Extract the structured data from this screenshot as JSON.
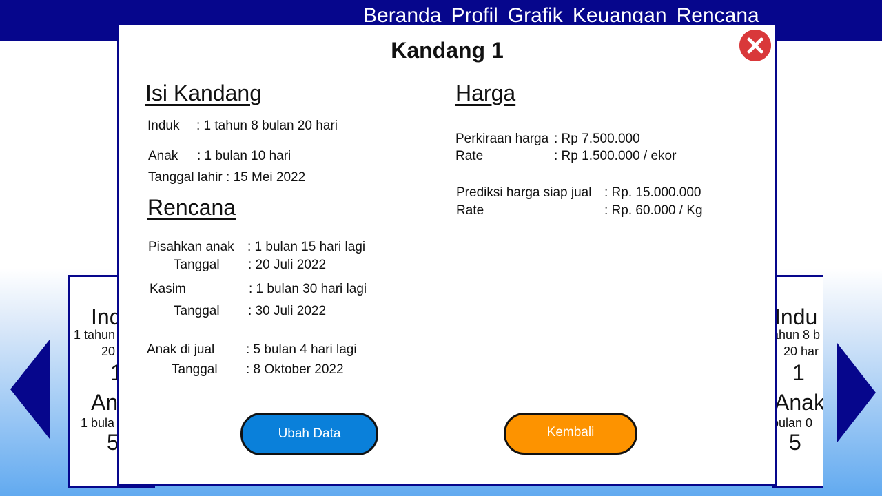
{
  "nav": {
    "items": [
      "Beranda",
      "Profil",
      "Grafik",
      "Keuangan",
      "Rencana"
    ]
  },
  "background_cards": {
    "left": {
      "title_induk": "Ind",
      "induk_line1": "1 tahun",
      "induk_line2": "20",
      "induk_count": "1",
      "title_anak": "An",
      "anak_line1": "1 bula",
      "anak_count": "5"
    },
    "right": {
      "title_induk": "Indu",
      "induk_line1": "ahun 8 b",
      "induk_line2": "20 har",
      "induk_count": "1",
      "title_anak": "Anak",
      "anak_line1": "bulan 0",
      "anak_count": "5"
    }
  },
  "modal": {
    "title": "Kandang 1",
    "isi": {
      "heading": "Isi Kandang",
      "induk_label": "Induk",
      "induk_value": ": 1 tahun  8 bulan 20 hari",
      "anak_label": "Anak",
      "anak_value": ": 1 bulan 10 hari",
      "tanggal_lahir": "Tanggal lahir : 15 Mei 2022"
    },
    "rencana": {
      "heading": "Rencana",
      "pisah_label": "Pisahkan anak",
      "pisah_value": ": 1 bulan 15 hari lagi",
      "pisah_tgl_label": "Tanggal",
      "pisah_tgl_value": ": 20 Juli 2022",
      "kasim_label": "Kasim",
      "kasim_value": ": 1 bulan 30 hari lagi",
      "kasim_tgl_label": "Tanggal",
      "kasim_tgl_value": ": 30 Juli 2022",
      "jual_label": "Anak di jual",
      "jual_value": ": 5 bulan 4 hari lagi",
      "jual_tgl_label": "Tanggal",
      "jual_tgl_value": ": 8 Oktober 2022"
    },
    "harga": {
      "heading": "Harga",
      "perkiraan_label": "Perkiraan harga",
      "perkiraan_value": ": Rp 7.500.000",
      "rate1_label": "Rate",
      "rate1_value": ": Rp 1.500.000 / ekor",
      "prediksi_label": "Prediksi harga siap jual",
      "prediksi_value": ": Rp. 15.000.000",
      "rate2_label": "Rate",
      "rate2_value": ": Rp. 60.000 / Kg"
    },
    "buttons": {
      "ubah": "Ubah Data",
      "kembali": "Kembali"
    }
  },
  "colors": {
    "navy": "#06068c",
    "close": "#d9383a",
    "ubah": "#0a80da",
    "kembali": "#fd9300"
  }
}
